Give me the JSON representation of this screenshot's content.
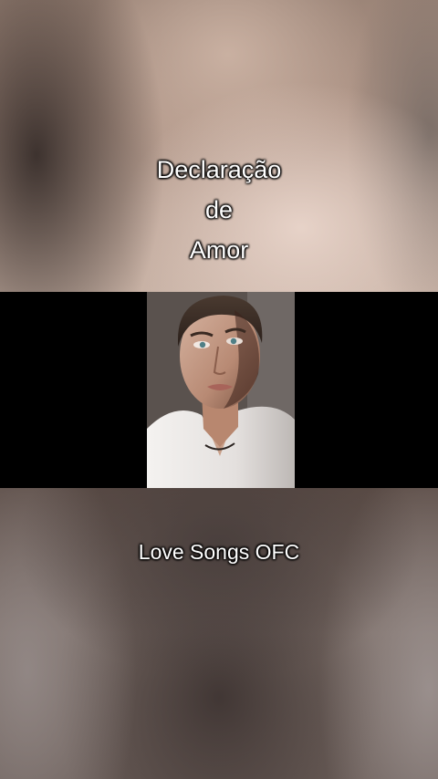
{
  "title_lines": [
    "Declaração",
    "de",
    "Amor"
  ],
  "subtitle": "Love Songs OFC",
  "image": {
    "subject": "portrait-of-man-in-white-shirt"
  },
  "colors": {
    "band": "#000000",
    "text": "#ffffff"
  }
}
